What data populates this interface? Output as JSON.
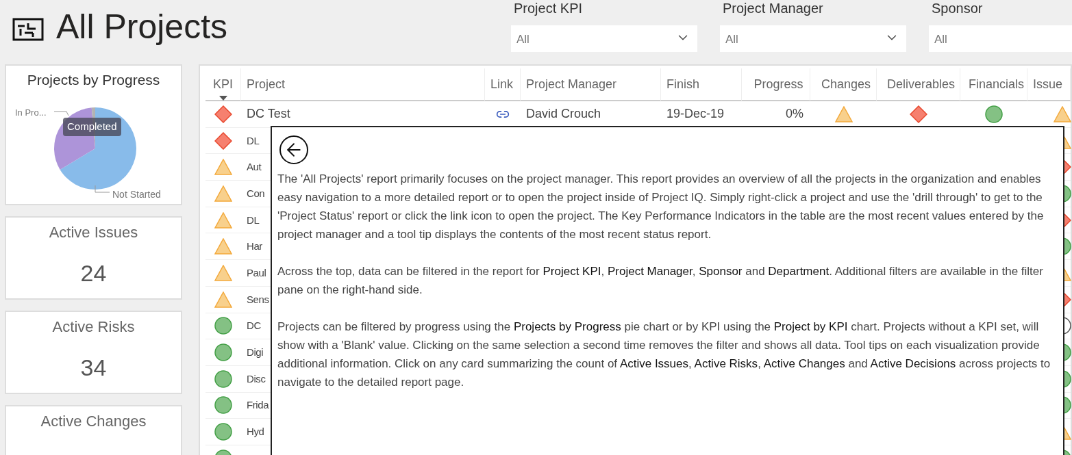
{
  "header": {
    "title": "All Projects"
  },
  "filters": [
    {
      "label": "Project KPI",
      "value": "All"
    },
    {
      "label": "Project Manager",
      "value": "All"
    },
    {
      "label": "Sponsor",
      "value": "All"
    }
  ],
  "progress_chart": {
    "title": "Projects by Progress",
    "in_progress_label": "In Pro...",
    "not_started_label": "Not Started",
    "tooltip": "Completed"
  },
  "cards": [
    {
      "title": "Active Issues",
      "value": "24"
    },
    {
      "title": "Active Risks",
      "value": "34"
    },
    {
      "title": "Active Changes"
    }
  ],
  "table": {
    "columns": [
      "KPI",
      "Project",
      "Link",
      "Project Manager",
      "Finish",
      "Progress",
      "Changes",
      "Deliverables",
      "Financials",
      "Issue"
    ],
    "rows": [
      {
        "kpi": {
          "kind": "diamond"
        },
        "project": "DC Test",
        "link": true,
        "manager": "David Crouch",
        "finish": "19-Dec-19",
        "progress": "0%",
        "changes": {
          "kind": "triangle"
        },
        "deliverables": {
          "kind": "diamond"
        },
        "financials": {
          "kind": "circle"
        },
        "issues": {
          "kind": "triangle"
        }
      },
      {
        "kpi": {
          "kind": "diamond"
        },
        "project": "DL",
        "issues": {
          "kind": "triangle"
        }
      },
      {
        "kpi": {
          "kind": "triangle"
        },
        "project": "Aut",
        "issues": {
          "kind": "diamond"
        }
      },
      {
        "kpi": {
          "kind": "triangle"
        },
        "project": "Con",
        "issues": {
          "kind": "circle"
        }
      },
      {
        "kpi": {
          "kind": "triangle"
        },
        "project": "DL",
        "issues": {
          "kind": "diamond"
        }
      },
      {
        "kpi": {
          "kind": "triangle"
        },
        "project": "Har",
        "issues": {
          "kind": "circle"
        }
      },
      {
        "kpi": {
          "kind": "triangle"
        },
        "project": "Paul",
        "issues": {
          "kind": "triangle"
        }
      },
      {
        "kpi": {
          "kind": "triangle"
        },
        "project": "Sens",
        "issues": {
          "kind": "diamond"
        }
      },
      {
        "kpi": {
          "kind": "circle"
        },
        "project": "DC",
        "issues": {
          "kind": "empty"
        }
      },
      {
        "kpi": {
          "kind": "circle"
        },
        "project": "Digi",
        "issues": {
          "kind": "circle"
        }
      },
      {
        "kpi": {
          "kind": "circle"
        },
        "project": "Disc",
        "issues": {
          "kind": "circle"
        }
      },
      {
        "kpi": {
          "kind": "circle"
        },
        "project": "Frida",
        "issues": {
          "kind": "circle"
        }
      },
      {
        "kpi": {
          "kind": "circle"
        },
        "project": "Hyd",
        "issues": {
          "kind": "triangle"
        }
      },
      {
        "kpi": {
          "kind": "circle"
        },
        "issues": {
          "kind": "circle"
        }
      }
    ]
  },
  "info_panel": {
    "paragraphs": [
      "The 'All Projects' report primarily focuses on the project manager. This report provides an overview of all the projects in the organization and enables easy navigation to a more detailed report or to open the project inside of Project IQ. Simply right-click a project and use the 'drill through' to get to the 'Project Status' report or click the link icon to open the project. The Key Performance Indicators in the table are the most recent values entered by the project manager and a tool tip displays the contents of the most recent status report.",
      "Across the top, data can be filtered in the report for **Project KPI**, **Project Manager**, **Sponsor** and **Department**. Additional filters are available in the filter pane on the right-hand side.",
      "Projects can be filtered by progress using the **Projects by Progress** pie chart or by KPI using the **Project by KPI** chart. Projects without a KPI set, will show with a 'Blank' value. Clicking on the same selection a second time removes the filter and shows all data. Tool tips on each visualization provide additional information. Click on any card summarizing the count of **Active Issues**, **Active Risks**, **Active Changes** and **Active Decisions** across projects to navigate to the detailed report page."
    ]
  }
}
